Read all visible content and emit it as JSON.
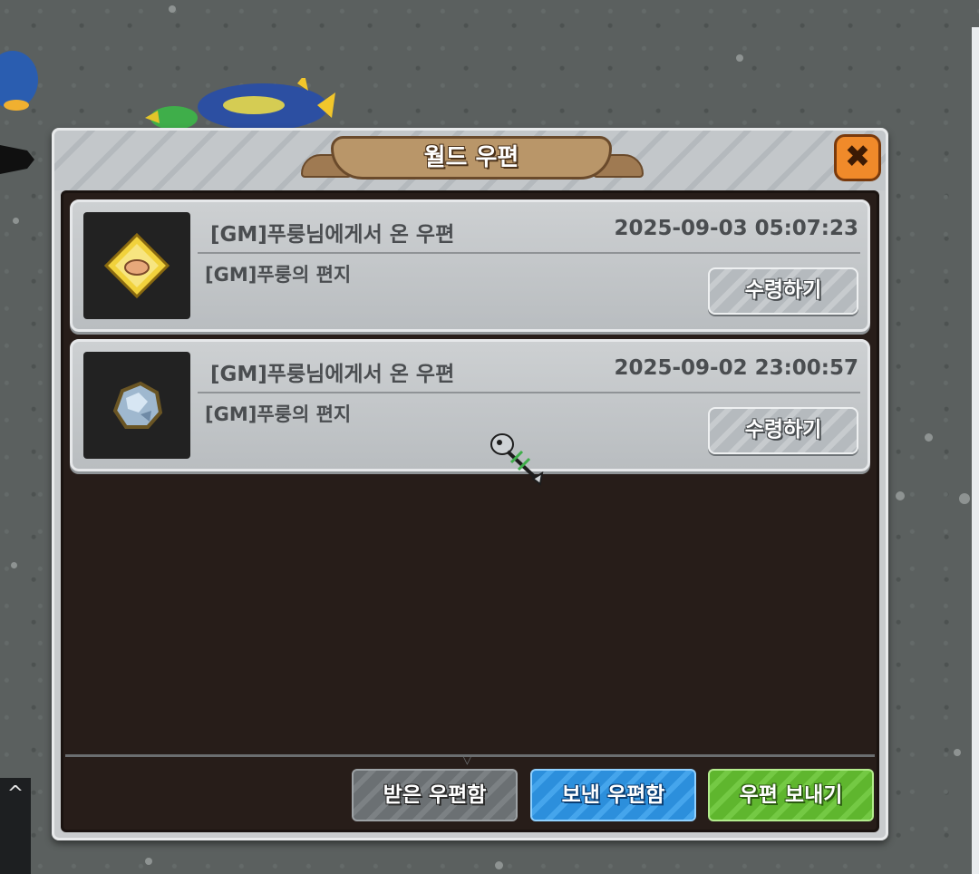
{
  "window": {
    "title": "월드 우편",
    "close_glyph": "✖"
  },
  "mails": [
    {
      "sender": "[GM]푸룽님에게서 온 우편",
      "date": "2025-09-03 05:07:23",
      "subject": "[GM]푸룽의 편지",
      "claim_label": "수령하기",
      "item_icon": "gold-ticket-icon"
    },
    {
      "sender": "[GM]푸룽님에게서 온 우편",
      "date": "2025-09-02 23:00:57",
      "subject": "[GM]푸룽의 편지",
      "claim_label": "수령하기",
      "item_icon": "crystal-ore-icon"
    }
  ],
  "footer": {
    "received_label": "받은 우편함",
    "sent_label": "보낸 우편함",
    "send_label": "우편 보내기"
  },
  "scroll_glyph": "^",
  "colors": {
    "received_tab": "#6b7073",
    "sent_tab": "#2c8fdc",
    "send_button": "#5fb62e",
    "close_button": "#f08a2a",
    "title_plate": "#b99669"
  }
}
